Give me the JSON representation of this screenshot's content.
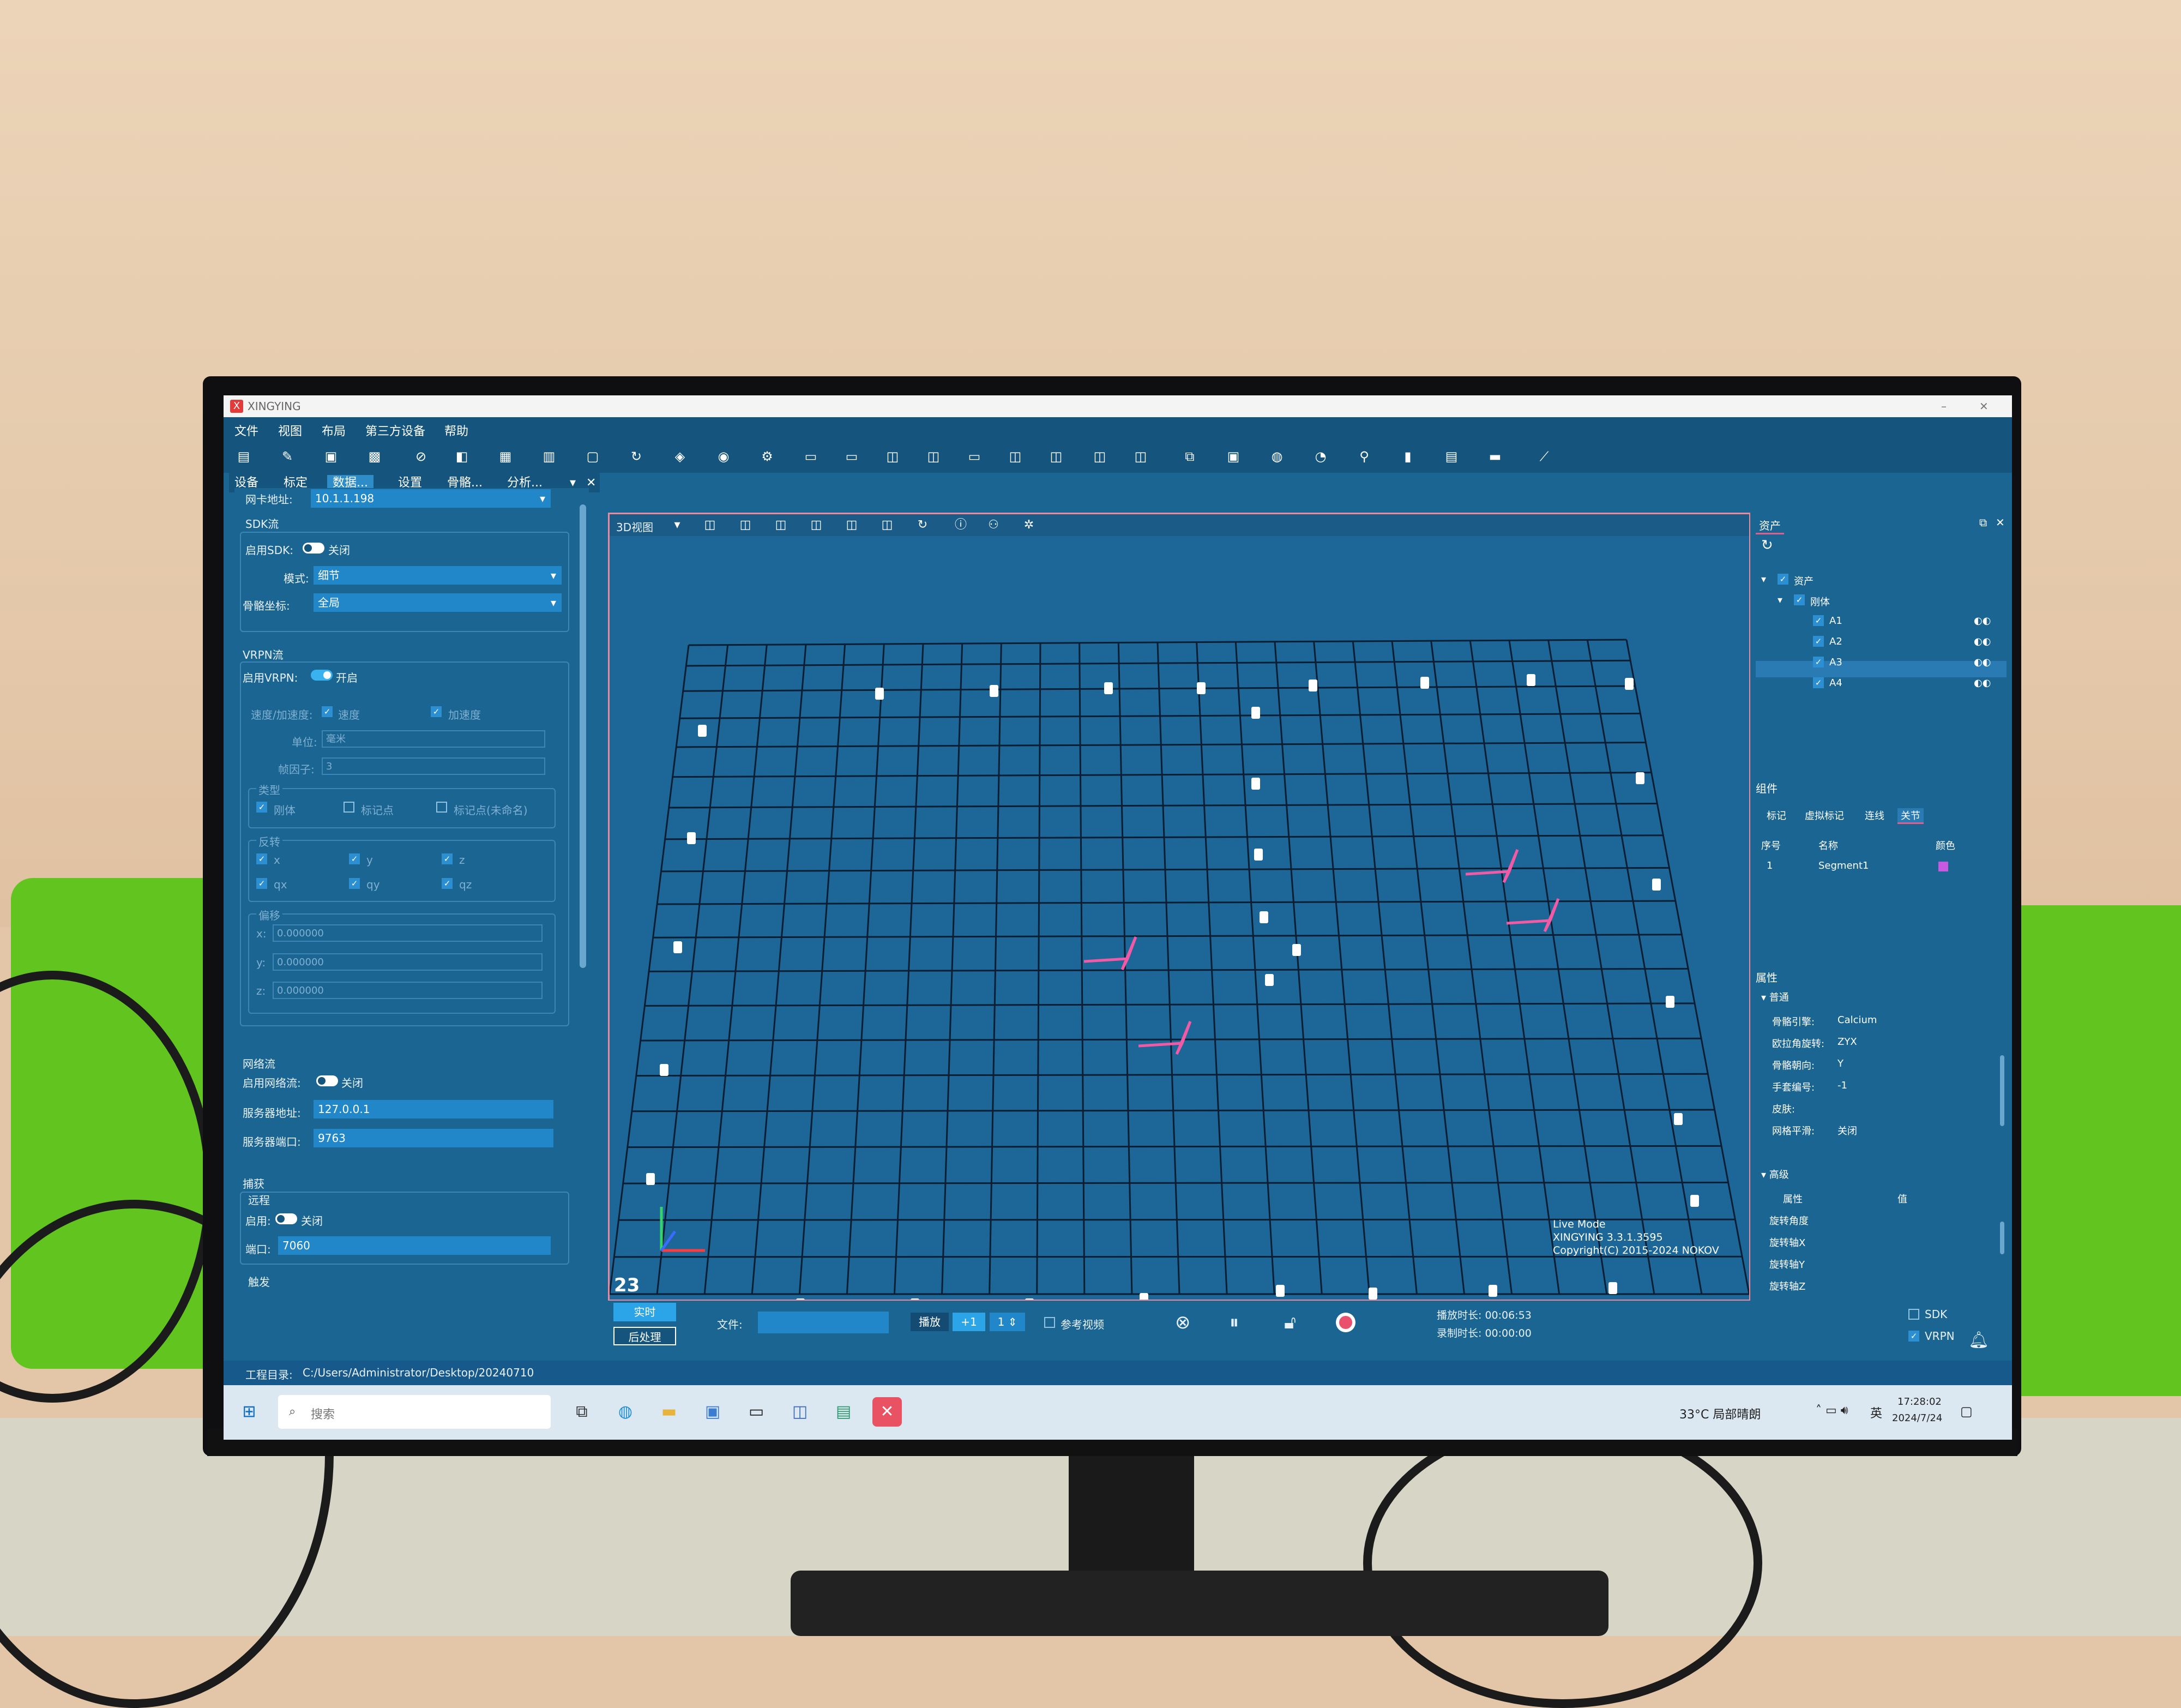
{
  "app": {
    "title": "XINGYING",
    "logo": "X"
  },
  "menu": [
    "文件",
    "视图",
    "布局",
    "第三方设备",
    "帮助"
  ],
  "left_tabs": [
    "设备",
    "标定",
    "数据...",
    "设置",
    "骨骼...",
    "分析..."
  ],
  "left_panel": {
    "top_field": {
      "label": "网卡地址:",
      "value": "10.1.1.198"
    },
    "sdk": {
      "title": "SDK流",
      "enable_label": "启用SDK:",
      "enable_state": "关闭",
      "mode_label": "模式:",
      "mode_value": "细节",
      "skel_label": "骨骼坐标:",
      "skel_value": "全局"
    },
    "vrpn": {
      "title": "VRPN流",
      "enable_label": "启用VRPN:",
      "enable_state": "开启",
      "rate_label": "速度/加速度:",
      "speed": "速度",
      "accel": "加速度",
      "unit_label": "单位:",
      "unit_value": "毫米",
      "frame_label": "帧因子:",
      "frame_value": "3",
      "type_title": "类型",
      "type_rigid": "刚体",
      "type_marker": "标记点",
      "type_unnamed": "标记点(未命名)",
      "flip_title": "反转",
      "x": "x",
      "y": "y",
      "z": "z",
      "qx": "qx",
      "qy": "qy",
      "qz": "qz",
      "offset_title": "偏移",
      "ox_label": "x:",
      "oy_label": "y:",
      "oz_label": "z:",
      "ox": "0.000000",
      "oy": "0.000000",
      "oz": "0.000000"
    },
    "network": {
      "title": "网络流",
      "enable_label": "启用网络流:",
      "enable_state": "关闭",
      "addr_label": "服务器地址:",
      "addr_value": "127.0.0.1",
      "port_label": "服务器端口:",
      "port_value": "9763"
    },
    "capture": {
      "title": "捕获",
      "remote_title": "远程",
      "enable_label": "启用:",
      "enable_state": "关闭",
      "port_label": "端口:",
      "port_value": "7060",
      "trigger_title": "触发"
    }
  },
  "viewport": {
    "title": "3D视图",
    "frame": "23",
    "live_mode": "Live Mode",
    "version": "XINGYING 3.3.1.3595",
    "copyright": "Copyright(C) 2015-2024 NOKOV"
  },
  "right_panel": {
    "assets_tab": "资产",
    "tree": {
      "root": "资产",
      "group": "刚体",
      "items": [
        "A1",
        "A2",
        "A3",
        "A4"
      ]
    },
    "components_title": "组件",
    "component_tabs": [
      "标记",
      "虚拟标记",
      "连线",
      "关节"
    ],
    "table_headers": [
      "序号",
      "名称",
      "颜色"
    ],
    "table_rows": [
      {
        "index": "1",
        "name": "Segment1",
        "color": "#c85ae0"
      }
    ],
    "props_title": "属性",
    "general_title": "普通",
    "props": [
      {
        "k": "骨骼引擎:",
        "v": "Calcium"
      },
      {
        "k": "欧拉角旋转:",
        "v": "ZYX"
      },
      {
        "k": "骨骼朝向:",
        "v": "Y"
      },
      {
        "k": "手套编号:",
        "v": "-1"
      },
      {
        "k": "皮肤:",
        "v": ""
      },
      {
        "k": "网格平滑:",
        "v": "关闭"
      }
    ],
    "advanced_title": "高级",
    "adv_headers": [
      "属性",
      "值"
    ],
    "adv_rows": [
      "旋转角度",
      "旋转轴X",
      "旋转轴Y",
      "旋转轴Z"
    ]
  },
  "bottom": {
    "realtime": "实时",
    "post": "后处理",
    "file_label": "文件:",
    "playback": "播放",
    "speed": "+1",
    "step": "1",
    "ref_video": "参考视频",
    "play_time_label": "播放时长:",
    "play_time": "00:06:53",
    "rec_time_label": "录制时长:",
    "rec_time": "00:00:00",
    "sdk": "SDK",
    "vrpn": "VRPN"
  },
  "status": {
    "project_label": "工程目录:",
    "project_path": "C:/Users/Administrator/Desktop/20240710"
  },
  "taskbar": {
    "search": "搜索",
    "weather": "33°C 局部晴朗",
    "lang": "英",
    "time": "17:28:02",
    "date": "2024/7/24"
  }
}
